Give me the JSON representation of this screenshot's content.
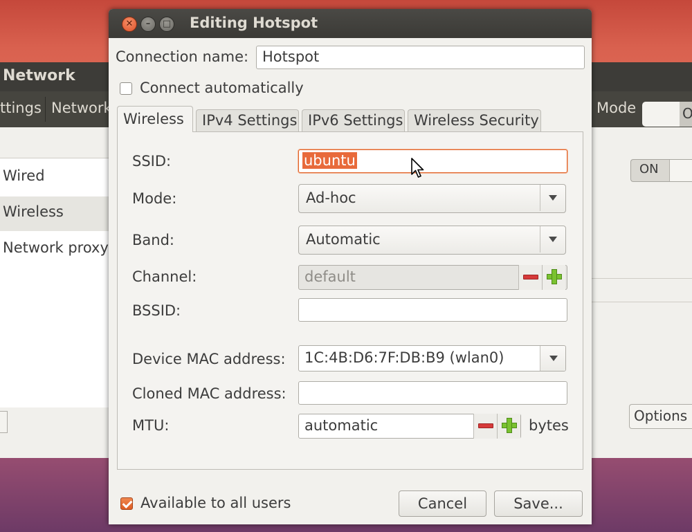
{
  "background_window": {
    "title": "Network",
    "toolbar": [
      "ttings",
      "Network"
    ],
    "mode_label": "Mode",
    "mode_switch_edge": "O",
    "sidebar_items": [
      "Wired",
      "Wireless",
      "Network proxy"
    ],
    "switch_label": "ON",
    "options_button": "Options"
  },
  "dialog": {
    "title": "Editing Hotspot",
    "connection_name_label": "Connection name:",
    "connection_name_value": "Hotspot",
    "connect_automatically_label": "Connect automatically",
    "connect_automatically": false,
    "tabs": [
      "Wireless",
      "IPv4 Settings",
      "IPv6 Settings",
      "Wireless Security"
    ],
    "active_tab": "Wireless",
    "fields": {
      "ssid_label": "SSID:",
      "ssid_value": "ubuntu",
      "mode_label": "Mode:",
      "mode_value": "Ad-hoc",
      "band_label": "Band:",
      "band_value": "Automatic",
      "channel_label": "Channel:",
      "channel_value": "default",
      "bssid_label": "BSSID:",
      "bssid_value": "",
      "device_mac_label": "Device MAC address:",
      "device_mac_value": "1C:4B:D6:7F:DB:B9 (wlan0)",
      "cloned_mac_label": "Cloned MAC address:",
      "cloned_mac_value": "",
      "mtu_label": "MTU:",
      "mtu_value": "automatic",
      "mtu_unit": "bytes"
    },
    "available_all_users_label": "Available to all users",
    "available_all_users": true,
    "cancel_button": "Cancel",
    "save_button": "Save..."
  },
  "colors": {
    "accent": "#e05a24",
    "selection": "#e86a3b",
    "titlebar": "#3d3c38",
    "dialog_bg": "#f2f1ed"
  },
  "icons": [
    "close-icon",
    "minimize-icon",
    "maximize-icon",
    "chevron-down-icon",
    "minus-icon",
    "plus-icon",
    "mouse-cursor-icon",
    "checkbox-checked-icon"
  ]
}
